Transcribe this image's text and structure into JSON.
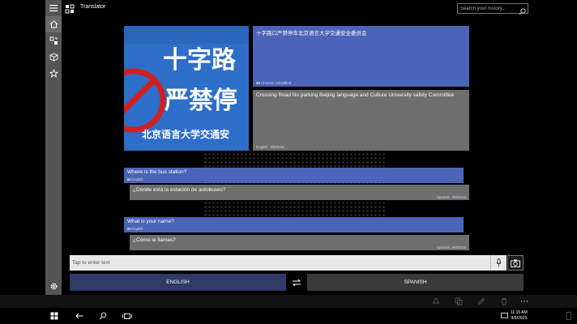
{
  "app": {
    "title": "Translator"
  },
  "search": {
    "placeholder": "Search your history..."
  },
  "sidebar": {
    "items": [
      {
        "name": "home",
        "icon": "home-icon"
      },
      {
        "name": "conversation",
        "icon": "translate-icon"
      },
      {
        "name": "phrasebook",
        "icon": "cube-icon"
      },
      {
        "name": "favorites",
        "icon": "star-icon"
      },
      {
        "name": "settings",
        "icon": "gear-icon"
      }
    ]
  },
  "photo": {
    "sign_line1": "十字路",
    "sign_line2": "严禁停",
    "sign_line3": "北京语言大学交通安"
  },
  "cards": [
    {
      "text": "十字路口严禁停车北京语言大学交通安全委员会",
      "meta": "Chinese Simplified"
    },
    {
      "text": "Crossing Road No parking Beijing language and Culture University safety Committee",
      "meta": "English, 9/9/2015"
    },
    {
      "text": "Where is the bus station?",
      "meta": "English"
    },
    {
      "text": "¿Dónde está la estación de autobuses?",
      "meta": "Spanish, 9/9/2015"
    },
    {
      "text": "What is your name?",
      "meta": "English"
    },
    {
      "text": "¿Cómo te llamas?",
      "meta": "Spanish, 9/9/2015"
    }
  ],
  "input": {
    "placeholder": "Tap to enter text"
  },
  "languages": {
    "from": "ENGLISH",
    "to": "SPANISH"
  },
  "clock": {
    "time": "11:15 AM",
    "date": "9/9/2015"
  },
  "colors": {
    "accent_blue": "#4b64b7",
    "card_gray": "#6e6e6e",
    "from_lang_bg": "#2f3a67",
    "sidebar": "#555555"
  }
}
